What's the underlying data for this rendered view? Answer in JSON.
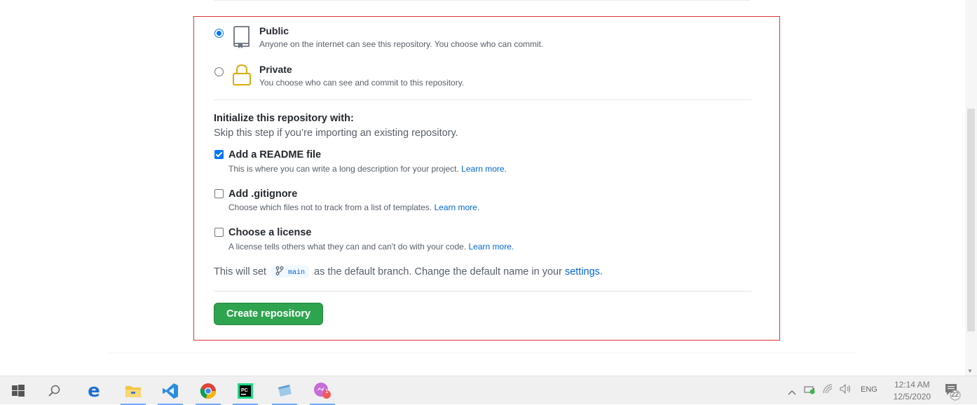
{
  "visibility": {
    "public": {
      "title": "Public",
      "description": "Anyone on the internet can see this repository. You choose who can commit.",
      "selected": true
    },
    "private": {
      "title": "Private",
      "description": "You choose who can see and commit to this repository.",
      "selected": false
    }
  },
  "initialize": {
    "title": "Initialize this repository with:",
    "subtitle": "Skip this step if you’re importing an existing repository.",
    "options": [
      {
        "label": "Add a README file",
        "description": "This is where you can write a long description for your project.",
        "link": "Learn more.",
        "checked": true
      },
      {
        "label": "Add .gitignore",
        "description": "Choose which files not to track from a list of templates.",
        "link": "Learn more.",
        "checked": false
      },
      {
        "label": "Choose a license",
        "description": "A license tells others what they can and can't do with your code.",
        "link": "Learn more.",
        "checked": false
      }
    ]
  },
  "branch": {
    "prefix": "This will set",
    "name": "main",
    "middle": "as the default branch. Change the default name in your",
    "link": "settings",
    "suffix": "."
  },
  "create_button": "Create repository",
  "taskbar": {
    "icons": [
      "windows-start-icon",
      "search-icon",
      "edge-icon",
      "file-explorer-icon",
      "vscode-icon",
      "chrome-icon",
      "pycharm-icon",
      "notepad-icon",
      "messenger-icon"
    ],
    "messenger_badge": "1",
    "language": "ENG",
    "time": "12:14 AM",
    "date": "12/5/2020",
    "notification_count": "22"
  },
  "colors": {
    "accent": "#0366d6",
    "button_green": "#2ea44f",
    "highlight_border": "#d93636",
    "radio_blue": "#0075ff"
  }
}
